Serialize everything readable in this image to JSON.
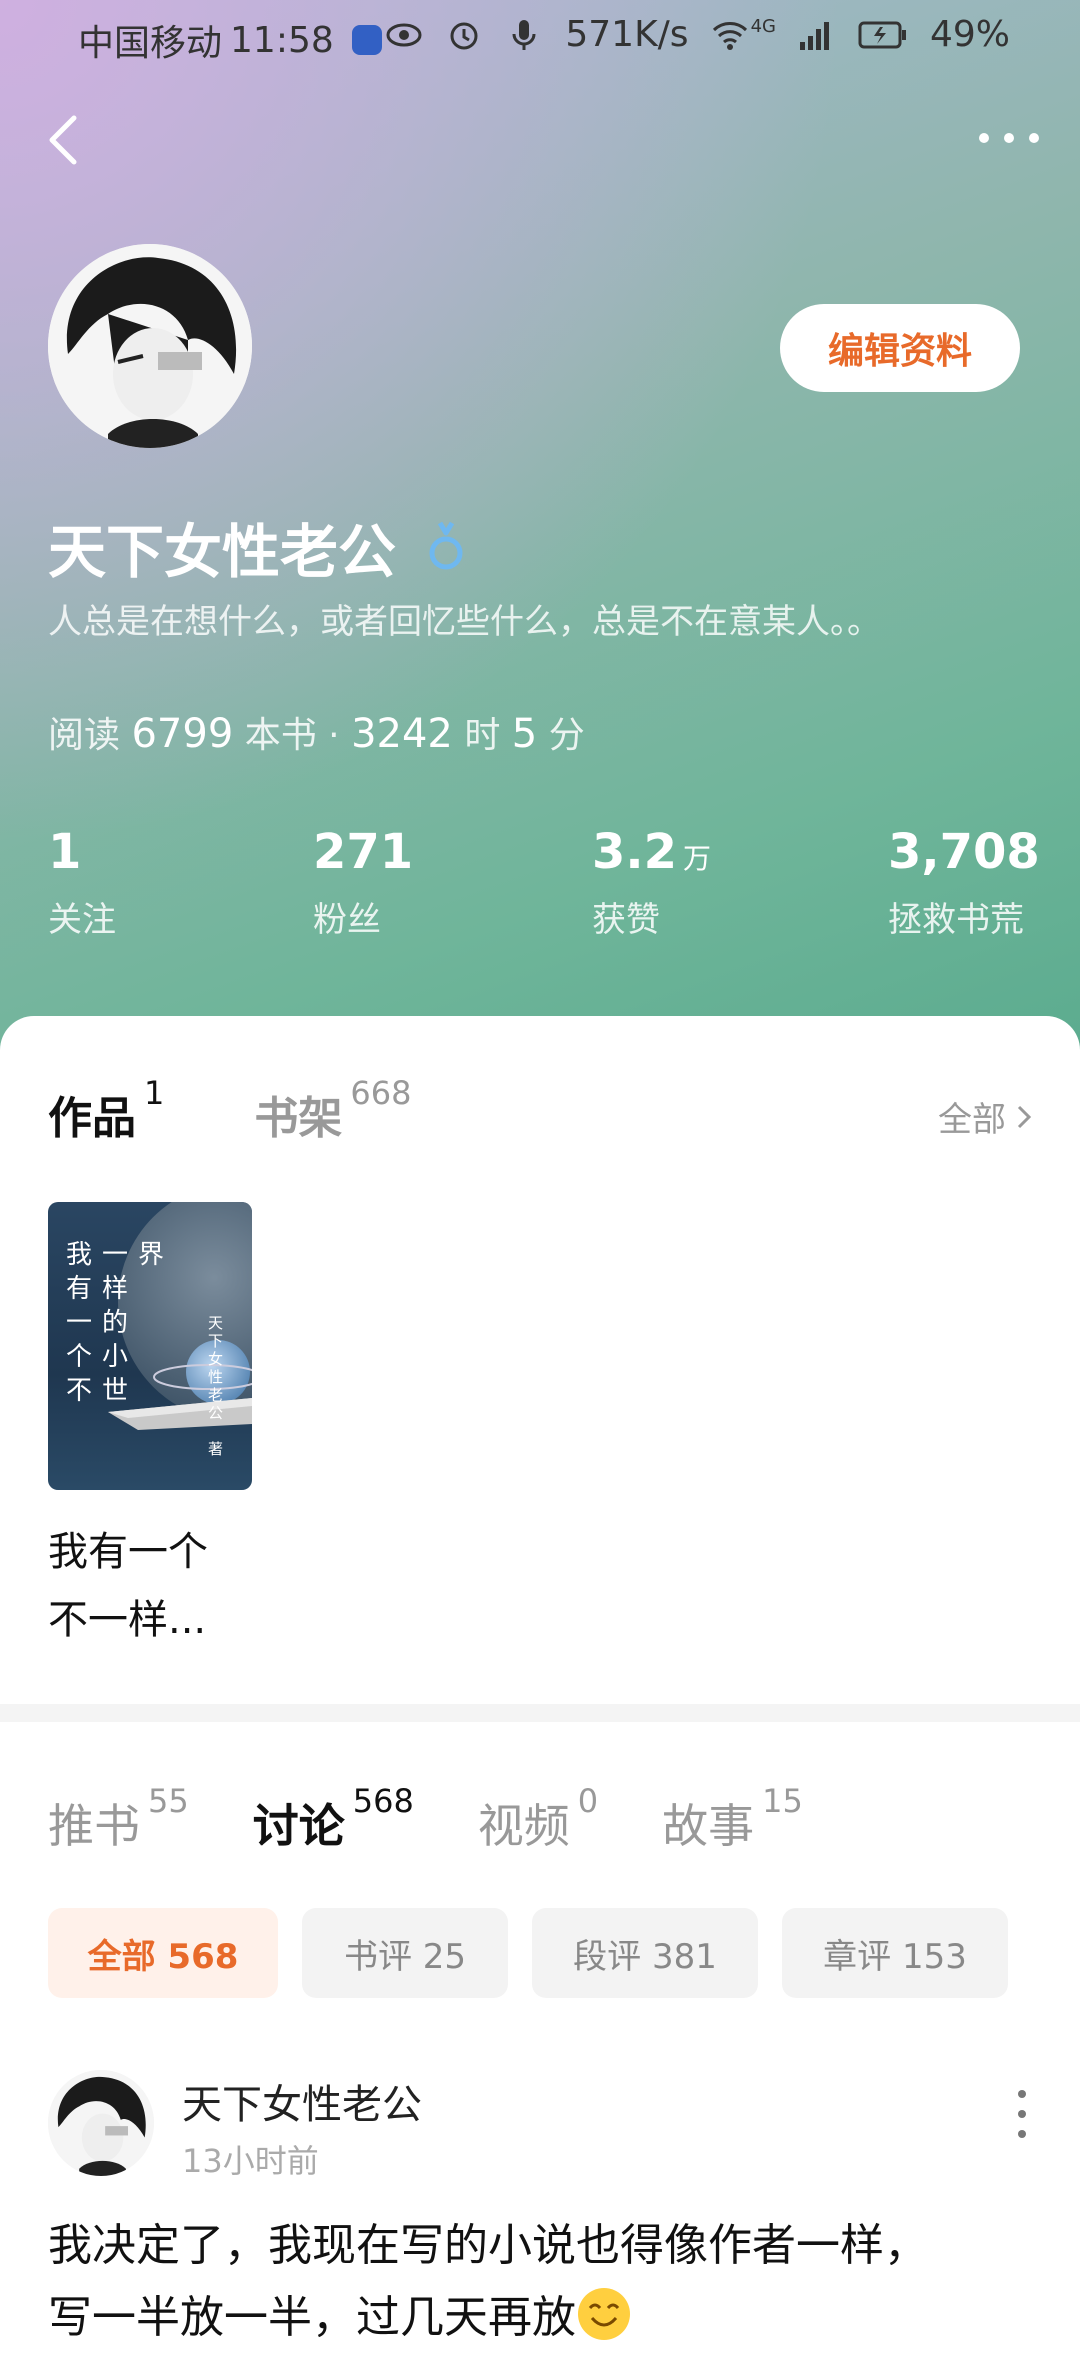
{
  "status_bar": {
    "carrier": "中国移动",
    "time": "11:58",
    "net_speed": "571K/s",
    "network": "4G",
    "battery": "49%"
  },
  "profile": {
    "edit_button": "编辑资料",
    "username": "天下女性老公",
    "bio": "人总是在想什么，或者回忆些什么，总是不在意某人。。",
    "reading_label": "阅读",
    "reading_books": "6799",
    "reading_books_unit": "本书 ·",
    "reading_hours": "3242",
    "reading_hours_unit": "时",
    "reading_minutes": "5",
    "reading_minutes_unit": "分",
    "stats": [
      {
        "num": "1",
        "unit": "",
        "label": "关注"
      },
      {
        "num": "271",
        "unit": "",
        "label": "粉丝"
      },
      {
        "num": "3.2",
        "unit": "万",
        "label": "获赞"
      },
      {
        "num": "3,708",
        "unit": "",
        "label": "拯救书荒"
      }
    ]
  },
  "works_tabs": {
    "works_label": "作品",
    "works_count": "1",
    "shelf_label": "书架",
    "shelf_count": "668",
    "all_link": "全部"
  },
  "book": {
    "cover_title_col1": "我有一个不",
    "cover_title_col2": "一样的小世",
    "cover_title_col3": "界",
    "cover_author": "天下女性老公",
    "cover_author_suffix": "著",
    "title_line1": "我有一个",
    "title_line2": "不一样..."
  },
  "feed_tabs": [
    {
      "label": "推书",
      "count": "55"
    },
    {
      "label": "讨论",
      "count": "568"
    },
    {
      "label": "视频",
      "count": "0"
    },
    {
      "label": "故事",
      "count": "15"
    }
  ],
  "chips": [
    {
      "label": "全部 568"
    },
    {
      "label": "书评 25"
    },
    {
      "label": "段评 381"
    },
    {
      "label": "章评 153"
    }
  ],
  "post": {
    "author": "天下女性老公",
    "time": "13小时前",
    "text_line1": "我决定了，我现在写的小说也得像作者一样，",
    "text_line2": "写一半放一半，过几天再放"
  },
  "colors": {
    "accent": "#e86a2a",
    "accent_bg": "#fff1ea",
    "gender_icon": "#6fb8f0"
  },
  "icons": {
    "back": "chevron-left-icon",
    "more": "more-horizontal-icon",
    "gender": "male-icon",
    "all_link": "chevron-right-icon",
    "post_more": "more-vertical-icon",
    "emoji": "smile-emoji-icon"
  }
}
